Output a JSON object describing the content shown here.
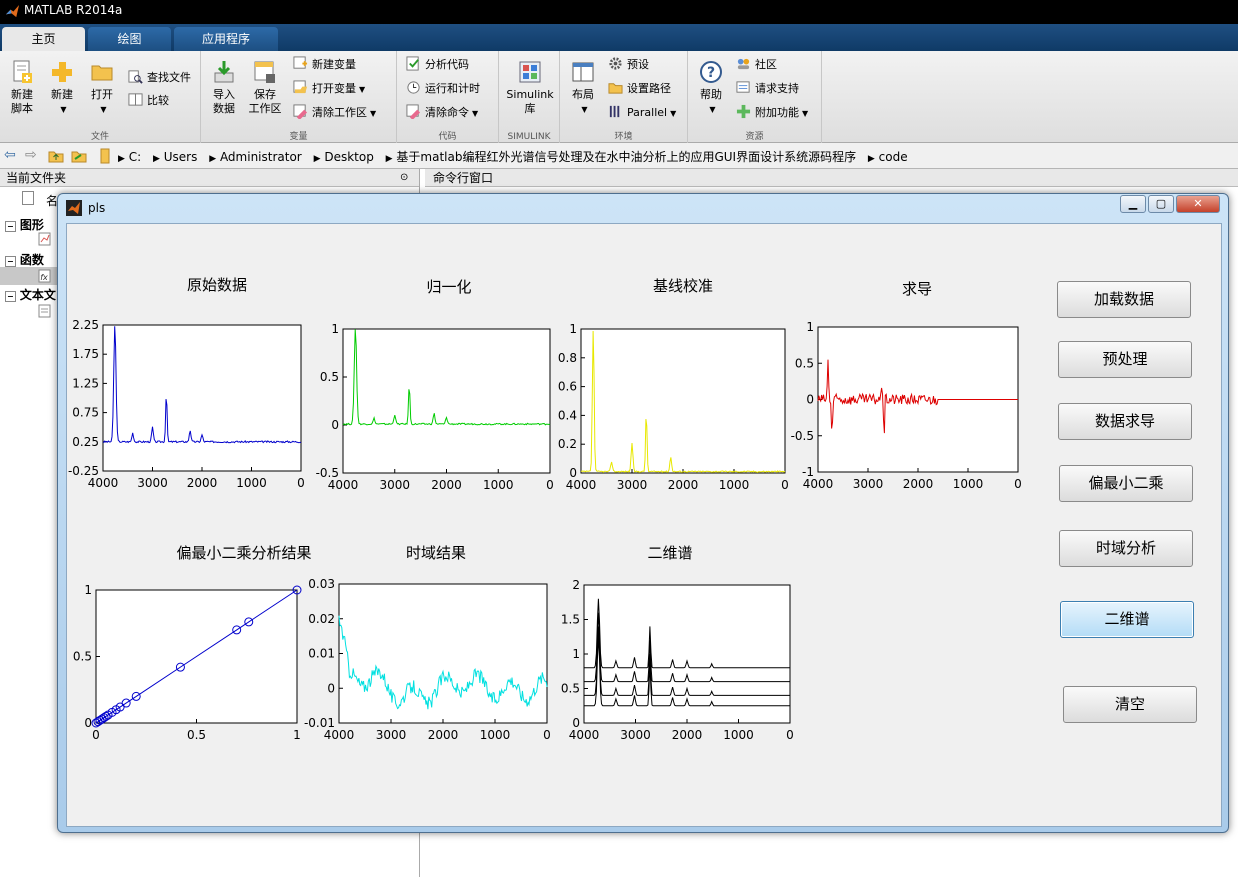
{
  "app": {
    "title": "MATLAB R2014a"
  },
  "tabs": [
    {
      "label": "主页"
    },
    {
      "label": "绘图"
    },
    {
      "label": "应用程序"
    }
  ],
  "ribbon": {
    "file": {
      "caption": "文件",
      "new_script": "新建\n脚本",
      "new_script_l1": "新建",
      "new_script_l2": "脚本",
      "new": "新建",
      "open": "打开",
      "find_files": "查找文件",
      "compare": "比较"
    },
    "variable": {
      "caption": "变量",
      "import_l1": "导入",
      "import_l2": "数据",
      "save_l1": "保存",
      "save_l2": "工作区",
      "new_var": "新建变量",
      "open_var": "打开变量",
      "clear_ws": "清除工作区"
    },
    "code": {
      "caption": "代码",
      "analyze": "分析代码",
      "run_time": "运行和计时",
      "clear_cmd": "清除命令"
    },
    "simulink": {
      "caption": "SIMULINK",
      "lib_l1": "Simulink",
      "lib_l2": "库"
    },
    "env": {
      "caption": "环境",
      "layout": "布局",
      "prefs": "预设",
      "set_path": "设置路径",
      "parallel": "Parallel"
    },
    "resources": {
      "caption": "资源",
      "help": "帮助",
      "community": "社区",
      "request_support": "请求支持",
      "addons": "附加功能"
    }
  },
  "address": {
    "crumbs": [
      "C:",
      "Users",
      "Administrator",
      "Desktop",
      "基于matlab编程红外光谱信号处理及在水中油分析上的应用GUI界面设计系统源码程序",
      "code"
    ]
  },
  "left_panel": {
    "title": "当前文件夹",
    "col_name": "名",
    "groups": [
      {
        "label": "图形"
      },
      {
        "label": "函数"
      },
      {
        "label": "文本文"
      }
    ]
  },
  "cmd_panel": {
    "title": "命令行窗口"
  },
  "figure": {
    "title": "pls",
    "buttons": {
      "load": "加载数据",
      "preprocess": "预处理",
      "derive": "数据求导",
      "pls": "偏最小二乘",
      "time": "时域分析",
      "twod": "二维谱",
      "clear": "清空"
    },
    "plots": [
      {
        "title": "原始数据",
        "yticks": [
          "2.25",
          "1.75",
          "1.25",
          "0.75",
          "0.25",
          "-0.25"
        ],
        "xticks": [
          "4000",
          "3000",
          "2000",
          "1000",
          "0"
        ],
        "color": "#0000cc"
      },
      {
        "title": "归一化",
        "yticks": [
          "1",
          "0.5",
          "0",
          "-0.5"
        ],
        "xticks": [
          "4000",
          "3000",
          "2000",
          "1000",
          "0"
        ],
        "color": "#00cc00"
      },
      {
        "title": "基线校准",
        "yticks": [
          "1",
          "0.8",
          "0.6",
          "0.4",
          "0.2",
          "0"
        ],
        "xticks": [
          "4000",
          "3000",
          "2000",
          "1000",
          "0"
        ],
        "color": "#e8e800"
      },
      {
        "title": "求导",
        "yticks": [
          "1",
          "0.5",
          "0",
          "-0.5",
          "-1"
        ],
        "xticks": [
          "4000",
          "3000",
          "2000",
          "1000",
          "0"
        ],
        "color": "#dd0000"
      },
      {
        "title": "偏最小二乘分析结果",
        "yticks": [
          "1",
          "0.5",
          "0"
        ],
        "xticks": [
          "0",
          "0.5",
          "1"
        ],
        "color": "#0000cc"
      },
      {
        "title": "时域结果",
        "yticks": [
          "0.03",
          "0.02",
          "0.01",
          "0",
          "-0.01"
        ],
        "xticks": [
          "4000",
          "3000",
          "2000",
          "1000",
          "0"
        ],
        "color": "#00e0e0"
      },
      {
        "title": "二维谱",
        "yticks": [
          "2",
          "1.5",
          "1",
          "0.5",
          "0"
        ],
        "xticks": [
          "4000",
          "3000",
          "2000",
          "1000",
          "0"
        ],
        "color": "#000000"
      }
    ]
  }
}
